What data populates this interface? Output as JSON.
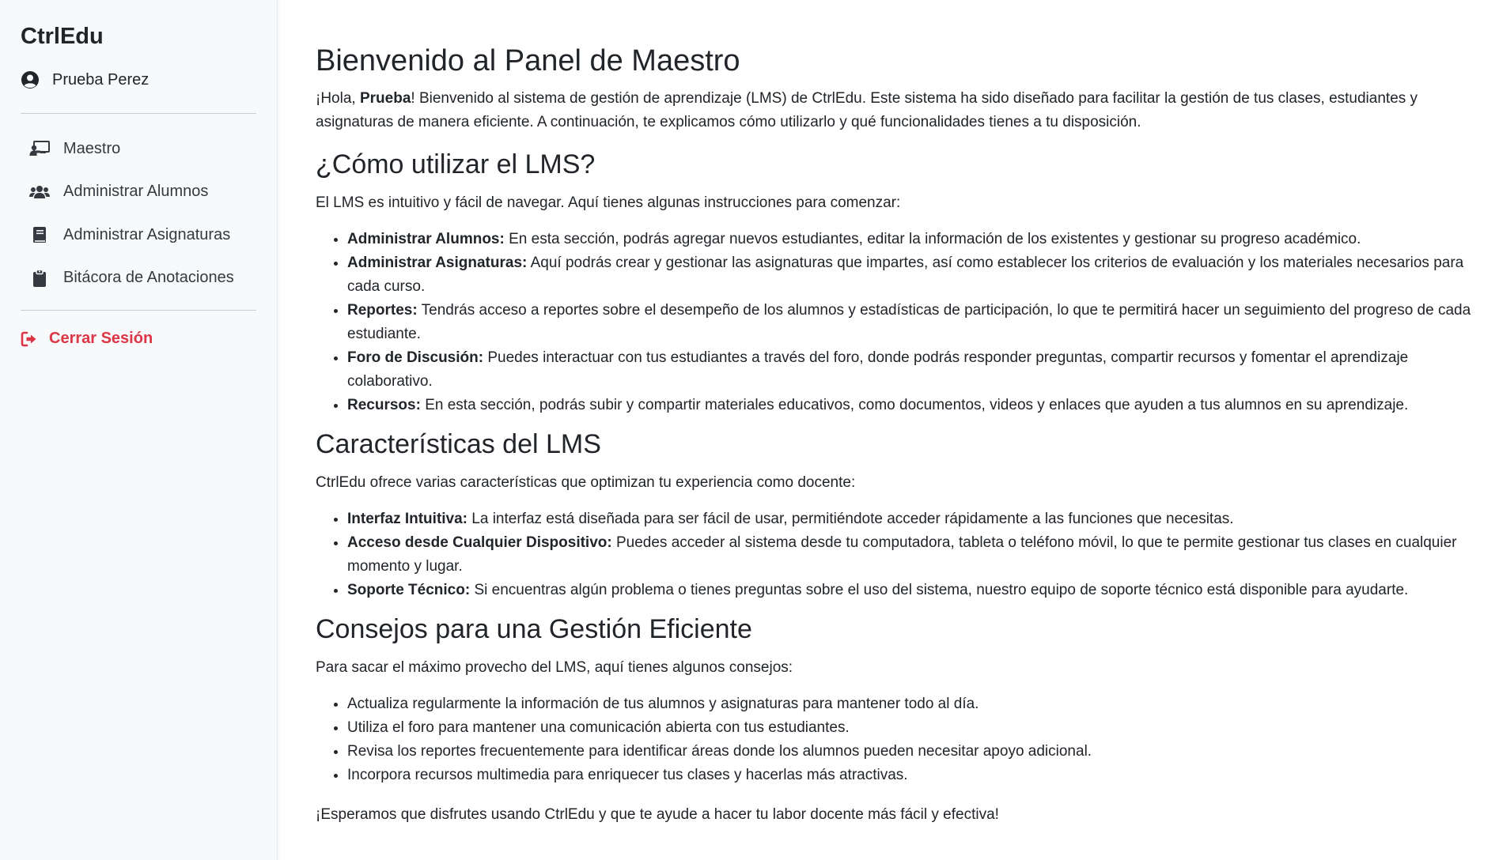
{
  "sidebar": {
    "brand": "CtrlEdu",
    "user_name": "Prueba Perez",
    "nav": [
      {
        "label": "Maestro",
        "icon": "chalkboard-teacher-icon"
      },
      {
        "label": "Administrar Alumnos",
        "icon": "users-icon"
      },
      {
        "label": "Administrar Asignaturas",
        "icon": "book-icon"
      },
      {
        "label": "Bitácora de Anotaciones",
        "icon": "clipboard-icon"
      }
    ],
    "logout_label": "Cerrar Sesión"
  },
  "colors": {
    "logout": "#dc3545",
    "sidebar_bg": "#f8f9fa",
    "text": "#212529"
  },
  "main": {
    "title": "Bienvenido al Panel de Maestro",
    "intro": {
      "prefix": "¡Hola, ",
      "name": "Prueba",
      "suffix": "! Bienvenido al sistema de gestión de aprendizaje (LMS) de CtrlEdu. Este sistema ha sido diseñado para facilitar la gestión de tus clases, estudiantes y asignaturas de manera eficiente. A continuación, te explicamos cómo utilizarlo y qué funcionalidades tienes a tu disposición."
    },
    "how_to": {
      "heading": "¿Cómo utilizar el LMS?",
      "text": "El LMS es intuitivo y fácil de navegar. Aquí tienes algunas instrucciones para comenzar:",
      "items": [
        {
          "term": "Administrar Alumnos:",
          "desc": " En esta sección, podrás agregar nuevos estudiantes, editar la información de los existentes y gestionar su progreso académico."
        },
        {
          "term": "Administrar Asignaturas:",
          "desc": " Aquí podrás crear y gestionar las asignaturas que impartes, así como establecer los criterios de evaluación y los materiales necesarios para cada curso."
        },
        {
          "term": "Reportes:",
          "desc": " Tendrás acceso a reportes sobre el desempeño de los alumnos y estadísticas de participación, lo que te permitirá hacer un seguimiento del progreso de cada estudiante."
        },
        {
          "term": "Foro de Discusión:",
          "desc": " Puedes interactuar con tus estudiantes a través del foro, donde podrás responder preguntas, compartir recursos y fomentar el aprendizaje colaborativo."
        },
        {
          "term": "Recursos:",
          "desc": " En esta sección, podrás subir y compartir materiales educativos, como documentos, videos y enlaces que ayuden a tus alumnos en su aprendizaje."
        }
      ]
    },
    "features": {
      "heading": "Características del LMS",
      "text": "CtrlEdu ofrece varias características que optimizan tu experiencia como docente:",
      "items": [
        {
          "term": "Interfaz Intuitiva:",
          "desc": " La interfaz está diseñada para ser fácil de usar, permitiéndote acceder rápidamente a las funciones que necesitas."
        },
        {
          "term": "Acceso desde Cualquier Dispositivo:",
          "desc": " Puedes acceder al sistema desde tu computadora, tableta o teléfono móvil, lo que te permite gestionar tus clases en cualquier momento y lugar."
        },
        {
          "term": "Soporte Técnico:",
          "desc": " Si encuentras algún problema o tienes preguntas sobre el uso del sistema, nuestro equipo de soporte técnico está disponible para ayudarte."
        }
      ]
    },
    "tips": {
      "heading": "Consejos para una Gestión Eficiente",
      "text": "Para sacar el máximo provecho del LMS, aquí tienes algunos consejos:",
      "items": [
        "Actualiza regularmente la información de tus alumnos y asignaturas para mantener todo al día.",
        "Utiliza el foro para mantener una comunicación abierta con tus estudiantes.",
        "Revisa los reportes frecuentemente para identificar áreas donde los alumnos pueden necesitar apoyo adicional.",
        "Incorpora recursos multimedia para enriquecer tus clases y hacerlas más atractivas."
      ]
    },
    "closing": "¡Esperamos que disfrutes usando CtrlEdu y que te ayude a hacer tu labor docente más fácil y efectiva!"
  }
}
